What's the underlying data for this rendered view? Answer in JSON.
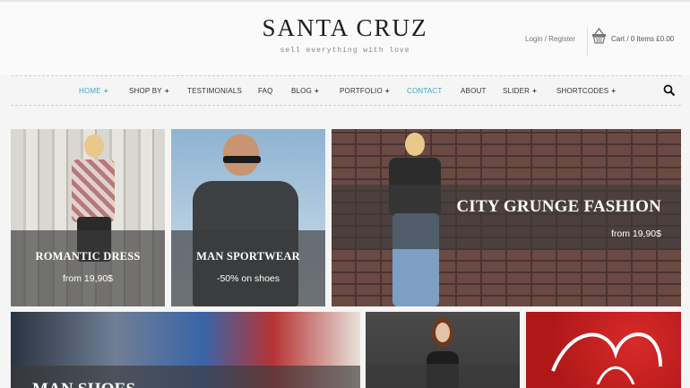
{
  "header": {
    "logo": "SANTA CRUZ",
    "tagline": "sell everything with love",
    "account_link": "Login / Register",
    "cart_summary": "Cart / 0 Items £0.00"
  },
  "nav": {
    "items": [
      {
        "label": "HOME",
        "has_submenu": true,
        "active": true
      },
      {
        "label": "SHOP BY",
        "has_submenu": true
      },
      {
        "label": "TESTIMONIALS",
        "has_submenu": false
      },
      {
        "label": "FAQ",
        "has_submenu": false
      },
      {
        "label": "BLOG",
        "has_submenu": true
      },
      {
        "label": "PORTFOLIO",
        "has_submenu": true
      },
      {
        "label": "CONTACT",
        "has_submenu": false,
        "highlight": true
      },
      {
        "label": "ABOUT",
        "has_submenu": false
      },
      {
        "label": "SLIDER",
        "has_submenu": true
      },
      {
        "label": "SHORTCODES",
        "has_submenu": true
      }
    ],
    "submenu_marker": "+",
    "search_icon": "search-icon"
  },
  "banners": {
    "romantic_dress": {
      "title": "ROMANTIC DRESS",
      "subtitle": "from 19,90$"
    },
    "man_sportwear": {
      "title": "MAN SPORTWEAR",
      "subtitle": "-50% on shoes"
    },
    "city_grunge": {
      "title": "CITY GRUNGE FASHION",
      "subtitle": "from 19,90$"
    },
    "man_shoes": {
      "title": "MAN SHOES"
    }
  },
  "colors": {
    "accent": "#3ea6c4",
    "overlay": "#3a3a3a",
    "text": "#333333"
  }
}
